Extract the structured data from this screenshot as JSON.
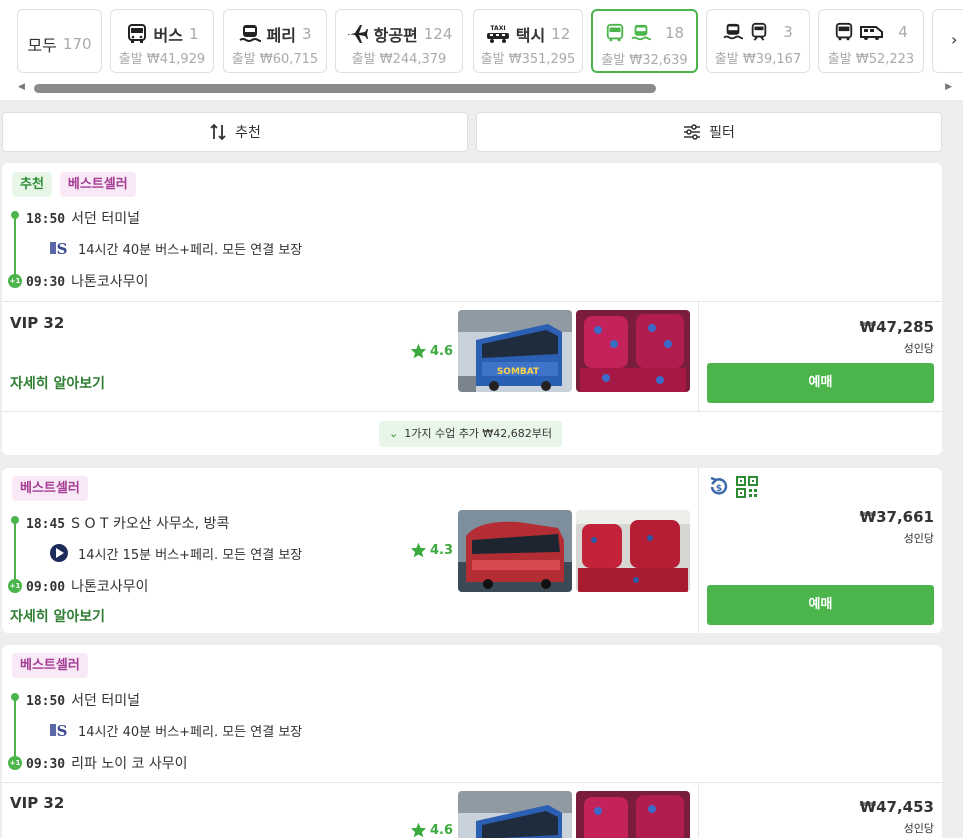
{
  "tabs": [
    {
      "name": "모두",
      "count": "170",
      "price": ""
    },
    {
      "name": "버스",
      "count": "1",
      "price": "출발 ₩41,929",
      "icon": "bus-icon"
    },
    {
      "name": "페리",
      "count": "3",
      "price": "출발 ₩60,715",
      "icon": "ferry-icon"
    },
    {
      "name": "항공편",
      "count": "124",
      "price": "출발 ₩244,379",
      "icon": "airplane-icon"
    },
    {
      "name": "택시",
      "count": "12",
      "price": "출발 ₩351,295",
      "icon": "taxi-icon",
      "icon_text": "TAXI"
    },
    {
      "name": "",
      "count": "18",
      "price": "출발 ₩32,639",
      "icon": "bus-ferry-icon"
    },
    {
      "name": "",
      "count": "3",
      "price": "출발 ₩39,167",
      "icon": "ferry-train-icon"
    },
    {
      "name": "",
      "count": "4",
      "price": "출발 ₩52,223",
      "icon": "bus-van-icon"
    }
  ],
  "tab_next": "›",
  "scroll": {
    "left_arrow": "◀",
    "right_arrow": "▶"
  },
  "sort_label": "추천",
  "filter_label": "필터",
  "colors": {
    "accent": "#4bb54c",
    "best_bg": "#f9e8f6",
    "best_text": "#a33c93"
  },
  "results": [
    {
      "badges": [
        "추천",
        "베스트셀러"
      ],
      "depart_time": "18:50",
      "depart_place": "서던 터미널",
      "via": "14시간 40분 버스+페리. 모든 연결 보장",
      "arrive_time": "09:30",
      "arrive_place": "나톤코사무이",
      "plus_day": "+1",
      "class_name": "VIP 32",
      "rating": "4.6",
      "more": "자세히 알아보기",
      "price": "₩47,285",
      "per": "성인당",
      "book": "예매",
      "more_classes": "1가지 수업 추가 ₩42,682부터"
    },
    {
      "badges": [
        "베스트셀러"
      ],
      "depart_time": "18:45",
      "depart_place": "S O T 카오산 사무소, 방콕",
      "via": "14시간 15분 버스+페리. 모든 연결 보장",
      "arrive_time": "09:00",
      "arrive_place": "나톤코사무이",
      "plus_day": "+1",
      "rating": "4.3",
      "more": "자세히 알아보기",
      "price": "₩37,661",
      "per": "성인당",
      "book": "예매"
    },
    {
      "badges": [
        "베스트셀러"
      ],
      "depart_time": "18:50",
      "depart_place": "서던 터미널",
      "via": "14시간 40분 버스+페리. 모든 연결 보장",
      "arrive_time": "09:30",
      "arrive_place": "리파 노이 코 사무이",
      "plus_day": "+1",
      "class_name": "VIP 32",
      "rating": "4.6",
      "price": "₩47,453",
      "per": "성인당"
    }
  ]
}
